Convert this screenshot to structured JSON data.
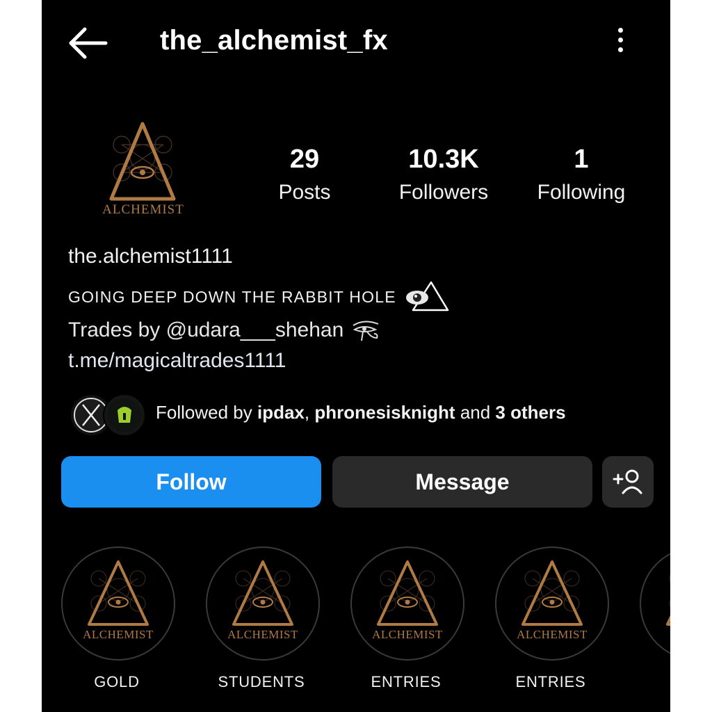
{
  "header": {
    "title": "the_alchemist_fx",
    "back_icon": "arrow-left-icon",
    "menu_icon": "more-vertical-icon"
  },
  "profile": {
    "avatar_text": "ALCHEMIST",
    "stats": [
      {
        "value": "29",
        "label": "Posts"
      },
      {
        "value": "10.3K",
        "label": "Followers"
      },
      {
        "value": "1",
        "label": "Following"
      }
    ],
    "name": "the.alchemist1111",
    "bio_line1": "GOING DEEP DOWN THE RABBIT HOLE",
    "bio_line2": "Trades by @udara___shehan",
    "link": "t.me/magicaltrades1111",
    "followed_by": {
      "prefix": "Followed by ",
      "user1": "ipdax",
      "sep": ", ",
      "user2": "phronesisknight",
      "and": " and ",
      "others": "3 others"
    }
  },
  "actions": {
    "follow_label": "Follow",
    "message_label": "Message",
    "add_user_icon": "add-user-icon"
  },
  "highlights": [
    {
      "label": "GOLD",
      "brand": "ALCHEMIST"
    },
    {
      "label": "STUDENTS",
      "brand": "ALCHEMIST"
    },
    {
      "label": "ENTRIES",
      "brand": "ALCHEMIST"
    },
    {
      "label": "ENTRIES",
      "brand": "ALCHEMIST"
    },
    {
      "label": "E",
      "brand": "AL"
    }
  ],
  "colors": {
    "background": "#000000",
    "follow_button": "#1a8ff0",
    "secondary_button": "#2a2a2a",
    "logo_gold": "#b07a45"
  }
}
